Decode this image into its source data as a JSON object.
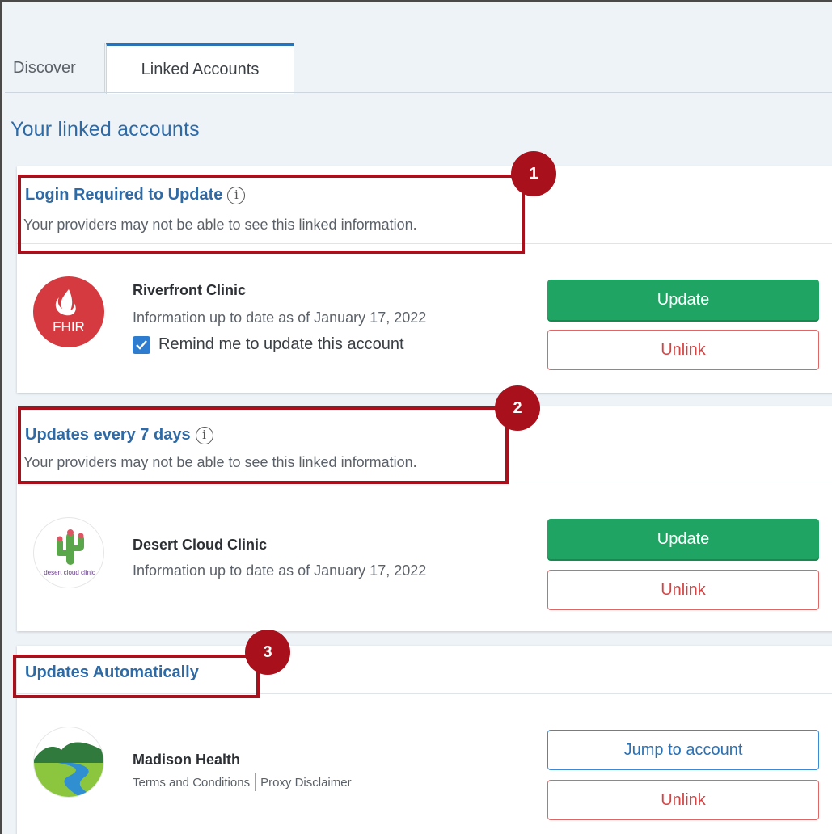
{
  "tabs": [
    {
      "label": "Discover",
      "active": false
    },
    {
      "label": "Linked Accounts",
      "active": true
    }
  ],
  "page_title": "Your linked accounts",
  "sections": [
    {
      "title": "Login Required to Update",
      "subtitle": "Your providers may not be able to see this linked information.",
      "callout": "1",
      "provider": {
        "logo": "fhir-flame-logo",
        "logo_text": "FHIR",
        "name": "Riverfront Clinic",
        "info": "Information up to date as of January 17, 2022",
        "remind_label": "Remind me to update this account",
        "remind_checked": true,
        "primary_button": "Update",
        "secondary_button": "Unlink"
      }
    },
    {
      "title": "Updates every 7 days",
      "subtitle": "Your providers may not be able to see this linked information.",
      "callout": "2",
      "provider": {
        "logo": "cactus-logo",
        "logo_text": "desert cloud clinic",
        "name": "Desert Cloud Clinic",
        "info": "Information up to date as of January 17, 2022",
        "primary_button": "Update",
        "secondary_button": "Unlink"
      }
    },
    {
      "title": "Updates Automatically",
      "callout": "3",
      "provider": {
        "logo": "river-hills-logo",
        "name": "Madison Health",
        "links": [
          "Terms and Conditions",
          "Proxy Disclaimer"
        ],
        "primary_button": "Jump to account",
        "secondary_button": "Unlink"
      }
    }
  ],
  "colors": {
    "accent": "#2b72b5",
    "update_green": "#1fa463",
    "unlink_red": "#d24545",
    "callout_red": "#a8101c",
    "background": "#eef3f8"
  }
}
